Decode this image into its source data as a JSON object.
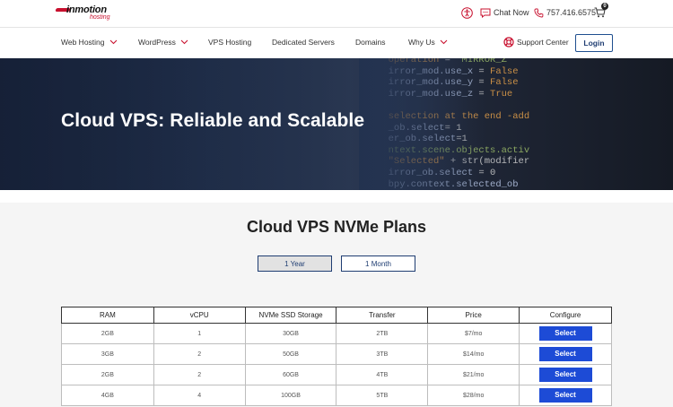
{
  "header": {
    "logo_text": "inmotion",
    "logo_sub": "hosting",
    "chat_label": "Chat Now",
    "phone": "757.416.6575",
    "cart_count": "0"
  },
  "nav": {
    "items": [
      {
        "label": "Web Hosting",
        "dropdown": true
      },
      {
        "label": "WordPress",
        "dropdown": true
      },
      {
        "label": "VPS Hosting",
        "dropdown": false
      },
      {
        "label": "Dedicated Servers",
        "dropdown": false
      },
      {
        "label": "Domains",
        "dropdown": false
      },
      {
        "label": "Why Us",
        "dropdown": true
      }
    ],
    "support_label": "Support Center",
    "login_label": "Login"
  },
  "hero": {
    "title": "Cloud VPS: Reliable and Scalable"
  },
  "plans": {
    "title": "Cloud VPS NVMe Plans",
    "toggles": [
      "1 Year",
      "1 Month"
    ],
    "active_toggle": "1 Year",
    "columns": [
      "RAM",
      "vCPU",
      "NVMe SSD Storage",
      "Transfer",
      "Price",
      "Configure"
    ],
    "rows": [
      {
        "ram": "2GB",
        "vcpu": "1",
        "storage": "30GB",
        "transfer": "2TB",
        "price": "$7/mo",
        "action": "Select"
      },
      {
        "ram": "3GB",
        "vcpu": "2",
        "storage": "50GB",
        "transfer": "3TB",
        "price": "$14/mo",
        "action": "Select"
      },
      {
        "ram": "2GB",
        "vcpu": "2",
        "storage": "60GB",
        "transfer": "4TB",
        "price": "$21/mo",
        "action": "Select"
      },
      {
        "ram": "4GB",
        "vcpu": "4",
        "storage": "100GB",
        "transfer": "5TB",
        "price": "$28/mo",
        "action": "Select"
      }
    ]
  },
  "colors": {
    "brand_red": "#c8102e",
    "navy": "#1f3d72",
    "select_blue": "#1d4bd6"
  },
  "icons": [
    "accessibility-icon",
    "chat-icon",
    "phone-icon",
    "cart-icon",
    "chevron-down-icon",
    "lifebuoy-icon"
  ]
}
